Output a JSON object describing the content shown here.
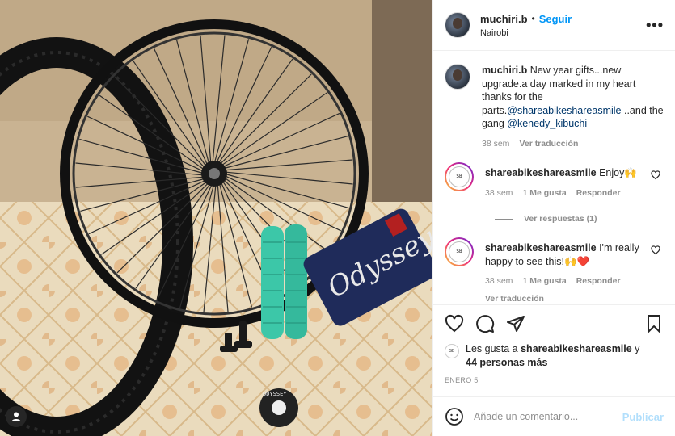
{
  "post": {
    "author": "muchiri.b",
    "follow_label": "Seguir",
    "separator": "•",
    "location": "Nairobi",
    "more_label": "•••"
  },
  "photo": {
    "bag_text": "Odyssey",
    "sticker_text": "ODYSSEY",
    "colors": {
      "grips": "#3cc7a8",
      "bag": "#1f2b5a",
      "wall": "#c8b18a",
      "floor": "#e8d4b0"
    }
  },
  "caption": {
    "username": "muchiri.b",
    "text_before": "New year gifts...new upgrade.a day marked in my heart thanks for the parts.",
    "mention1": "@shareabikeshareasmile",
    "text_middle": " ..and the gang ",
    "mention2": "@kenedy_kibuchi",
    "time": "38 sem",
    "translate": "Ver traducción"
  },
  "comments": [
    {
      "username": "shareabikeshareasmile",
      "text": "Enjoy🙌",
      "time": "38 sem",
      "likes": "1 Me gusta",
      "reply": "Responder"
    },
    {
      "username": "shareabikeshareasmile",
      "text": "I'm really happy to see this!🙌❤️",
      "time": "38 sem",
      "likes": "1 Me gusta",
      "reply": "Responder",
      "translate": "Ver traducción"
    }
  ],
  "view_replies": "Ver respuestas (1)",
  "likes": {
    "prefix": "Les gusta a ",
    "user": "shareabikeshareasmile",
    "middle": " y",
    "count": "44 personas más"
  },
  "date": "ENERO 5",
  "add_comment": {
    "placeholder": "Añade un comentario...",
    "publish": "Publicar"
  },
  "icons": [
    "heart-icon",
    "comment-icon",
    "share-icon",
    "bookmark-icon",
    "emoji-icon",
    "more-icon",
    "user-tag-icon"
  ]
}
